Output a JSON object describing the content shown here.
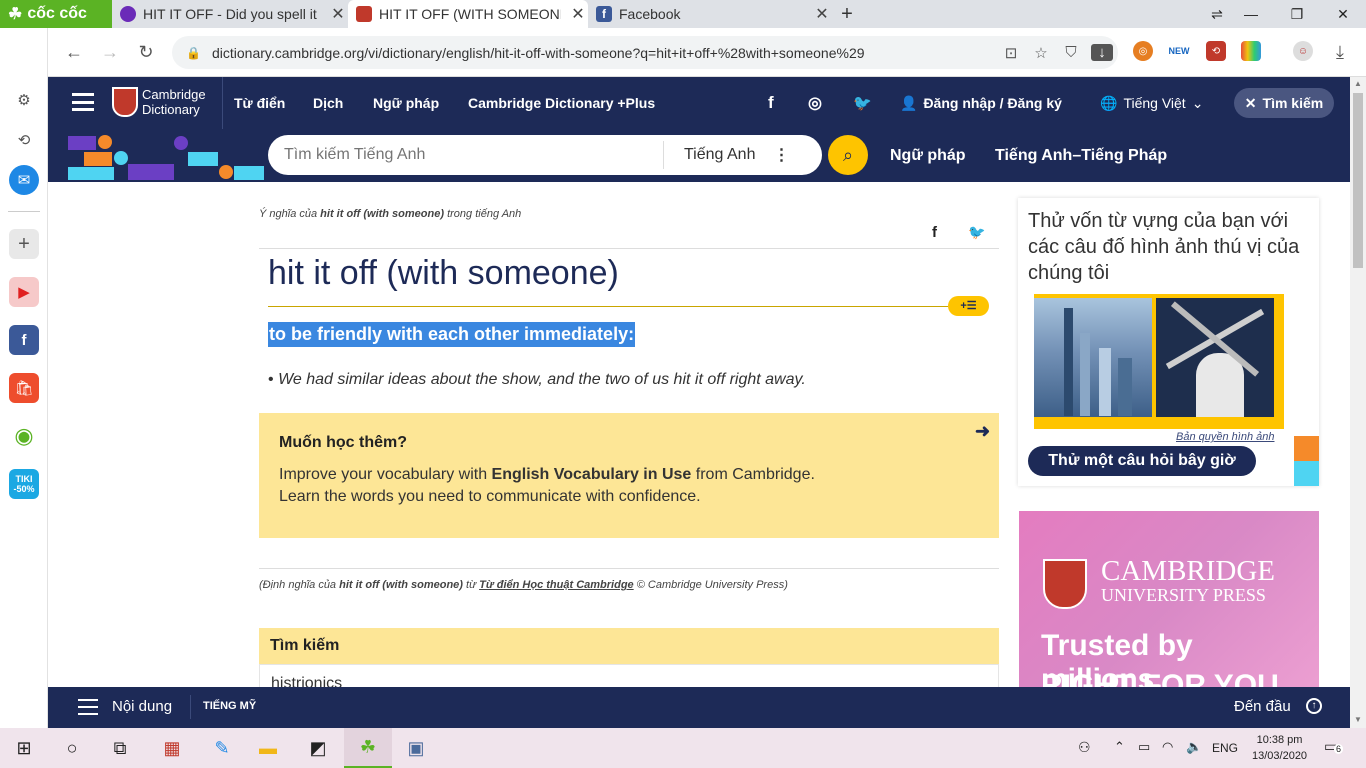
{
  "browser": {
    "brand": "cốc cốc",
    "tabs": [
      {
        "title": "HIT IT OFF - Did you spell it c",
        "active": false
      },
      {
        "title": "HIT IT OFF (WITH SOMEONE)",
        "active": true
      },
      {
        "title": "Facebook",
        "active": false
      }
    ],
    "url": "dictionary.cambridge.org/vi/dictionary/english/hit-it-off-with-someone?q=hit+it+off+%28with+someone%29",
    "new_badge": "NEW"
  },
  "sidebar": {
    "tiki_label": "TIKI",
    "tiki_discount": "-50%"
  },
  "site": {
    "logo_line1": "Cambridge",
    "logo_line2": "Dictionary",
    "nav": [
      "Từ điển",
      "Dịch",
      "Ngữ pháp",
      "Cambridge Dictionary +Plus"
    ],
    "login": "Đăng nhập / Đăng ký",
    "language": "Tiếng Việt",
    "search_toggle": "Tìm kiếm",
    "search_placeholder": "Tìm kiếm Tiếng Anh",
    "search_lang": "Tiếng Anh",
    "nav2": [
      "Ngữ pháp",
      "Tiếng Anh–Tiếng Pháp"
    ]
  },
  "entry": {
    "meaning_prefix": "Ý nghĩa của",
    "meaning_term": "hit it off (with someone)",
    "meaning_suffix": "trong tiếng Anh",
    "headword": "hit it off (with someone)",
    "definition": "to be friendly with each other immediately:",
    "bullet": "•",
    "example": "We had similar ideas about the show, and the two of us hit it off right away.",
    "learn_title": "Muốn học thêm?",
    "learn_line1_a": "Improve your vocabulary with",
    "learn_line1_b": "English Vocabulary in Use",
    "learn_line1_c": "from Cambridge.",
    "learn_line2": "Learn the words you need to communicate with confidence.",
    "credit_a": "(Định nghĩa của",
    "credit_b": "hit it off (with someone)",
    "credit_c": "từ",
    "credit_d": "Từ điển Học thuật Cambridge",
    "credit_e": "© Cambridge University Press)",
    "search_head": "Tìm kiếm",
    "search_item": "histrionics"
  },
  "quiz": {
    "text": "Thử vốn từ vựng của bạn với các câu đố hình ảnh thú vị của chúng tôi",
    "copyright": "Bản quyền hình ảnh",
    "button": "Thử một câu hỏi bây giờ"
  },
  "ad": {
    "line1": "CAMBRIDGE",
    "line2": "UNIVERSITY PRESS",
    "tagline1": "Trusted by millions,",
    "tagline2": "RIGHT FOR YOU"
  },
  "bottom": {
    "contents": "Nội dung",
    "region": "TIẾNG MỸ",
    "top": "Đến đầu"
  },
  "taskbar": {
    "lang": "ENG",
    "time": "10:38 pm",
    "date": "13/03/2020",
    "notif": "6"
  },
  "colors": {
    "navy": "#1d2a57",
    "yellow": "#fec400",
    "highlight": "#3a87e0",
    "panel": "#fde696"
  }
}
